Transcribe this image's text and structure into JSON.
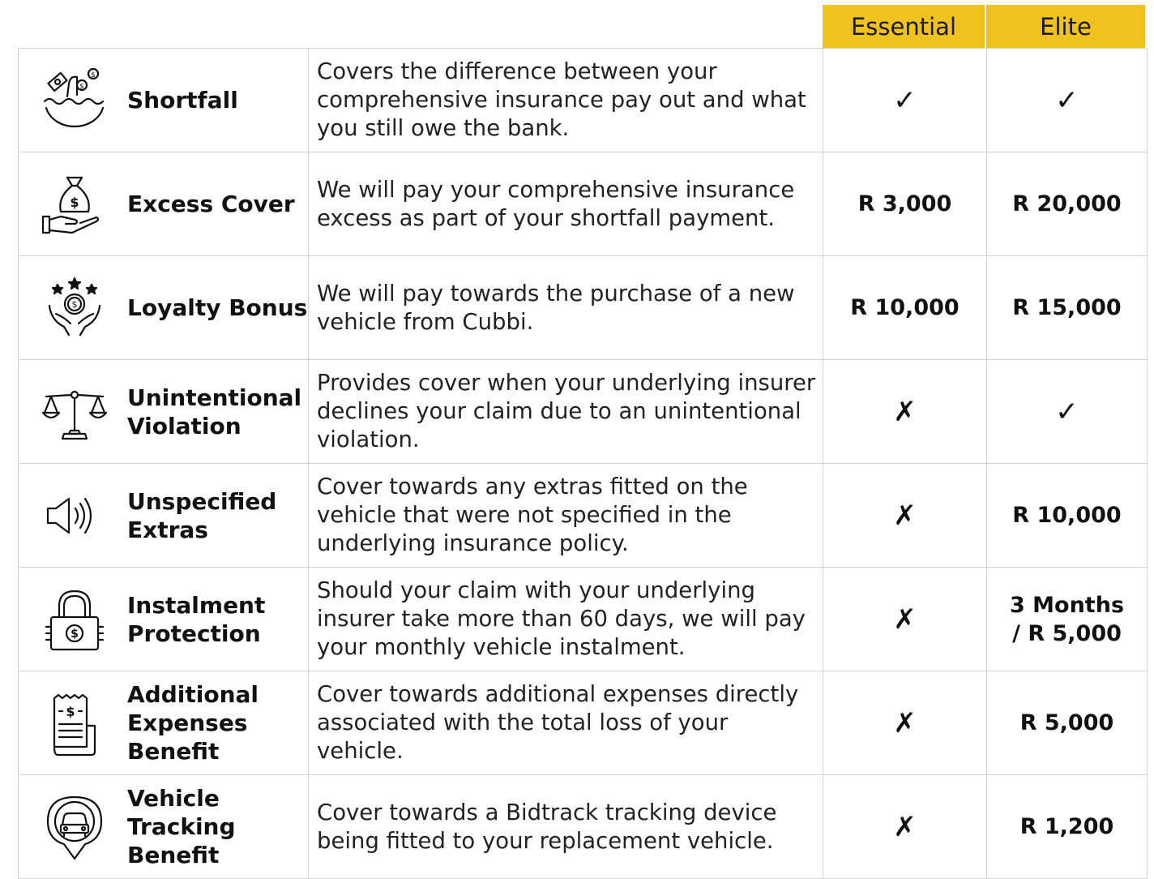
{
  "header": {
    "essential": "Essential",
    "elite": "Elite",
    "accent_color": "#efc21d"
  },
  "rows": [
    {
      "name": "Shortfall",
      "icon": "shortfall-money-icon",
      "description": "Covers the difference between your comprehensive insurance pay out and what you still owe the bank.",
      "essential": "✓",
      "elite": "✓"
    },
    {
      "name": "Excess Cover",
      "icon": "hand-money-bag-icon",
      "description": "We will pay your comprehensive insurance excess as part of your shortfall payment.",
      "essential": "R 3,000",
      "elite": "R 20,000"
    },
    {
      "name": "Loyalty Bonus",
      "icon": "hands-coin-stars-icon",
      "description": "We will pay towards the purchase of a new vehicle from Cubbi.",
      "essential": "R 10,000",
      "elite": "R 15,000"
    },
    {
      "name": "Unintentional Violation",
      "icon": "scales-icon",
      "description": "Provides cover when your underlying insurer declines your claim due to an unintentional violation.",
      "essential": "✗",
      "elite": "✓"
    },
    {
      "name": "Unspecified Extras",
      "icon": "speaker-icon",
      "description": "Cover towards any extras fitted on the vehicle that were not specified in the underlying insurance policy.",
      "essential": "✗",
      "elite": "R 10,000"
    },
    {
      "name": "Instalment Protection",
      "icon": "padlock-dollar-icon",
      "description": "Should your claim with your underlying insurer take more than 60 days, we will pay your monthly vehicle instalment.",
      "essential": "✗",
      "elite": "3 Months / R 5,000"
    },
    {
      "name": "Additional Expenses Benefit",
      "icon": "receipt-icon",
      "description": "Cover towards additional expenses directly associated with the total loss of your vehicle.",
      "essential": "✗",
      "elite": "R 5,000"
    },
    {
      "name": "Vehicle Tracking Benefit",
      "icon": "car-location-pin-icon",
      "description": "Cover towards a Bidtrack tracking device being fitted to your replacement vehicle.",
      "essential": "✗",
      "elite": "R 1,200"
    }
  ]
}
